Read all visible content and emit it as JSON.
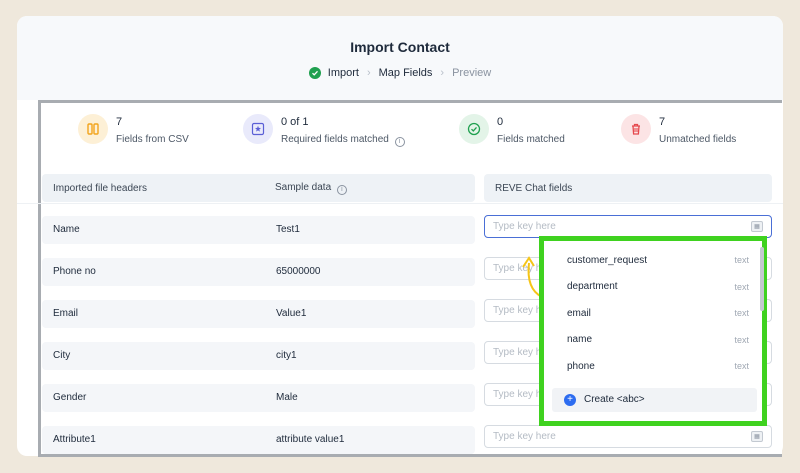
{
  "header": {
    "title": "Import Contact",
    "steps": [
      {
        "label": "Import",
        "state": "done"
      },
      {
        "label": "Map Fields",
        "state": "current"
      },
      {
        "label": "Preview",
        "state": "upcoming"
      }
    ]
  },
  "stats": [
    {
      "value": "7",
      "label": "Fields from CSV",
      "icon": "columns-icon",
      "color": "#f2a41c"
    },
    {
      "value": "0 of 1",
      "label": "Required fields matched",
      "icon": "star-box-icon",
      "color": "#5b5fd6"
    },
    {
      "value": "0",
      "label": "Fields matched",
      "icon": "check-circle-icon",
      "color": "#1fa04f"
    },
    {
      "value": "7",
      "label": "Unmatched fields",
      "icon": "trash-icon",
      "color": "#e5484d"
    }
  ],
  "table": {
    "headers": [
      "Imported file headers",
      "Sample data",
      "REVE Chat fields"
    ],
    "rows": [
      {
        "header": "Name",
        "sample": "Test1"
      },
      {
        "header": "Phone no",
        "sample": "65000000"
      },
      {
        "header": "Email",
        "sample": "Value1"
      },
      {
        "header": "City",
        "sample": "city1"
      },
      {
        "header": "Gender",
        "sample": "Male"
      },
      {
        "header": "Attribute1",
        "sample": "attribute value1"
      }
    ],
    "field_placeholder": "Type key here"
  },
  "dropdown": {
    "items": [
      {
        "name": "customer_request",
        "type": "text"
      },
      {
        "name": "department",
        "type": "text"
      },
      {
        "name": "email",
        "type": "text"
      },
      {
        "name": "name",
        "type": "text"
      },
      {
        "name": "phone",
        "type": "text"
      }
    ],
    "create_label": "Create <abc>"
  },
  "colors": {
    "accent": "#2d6cf0",
    "highlight": "#3fd21f",
    "arrow": "#f5c518"
  }
}
